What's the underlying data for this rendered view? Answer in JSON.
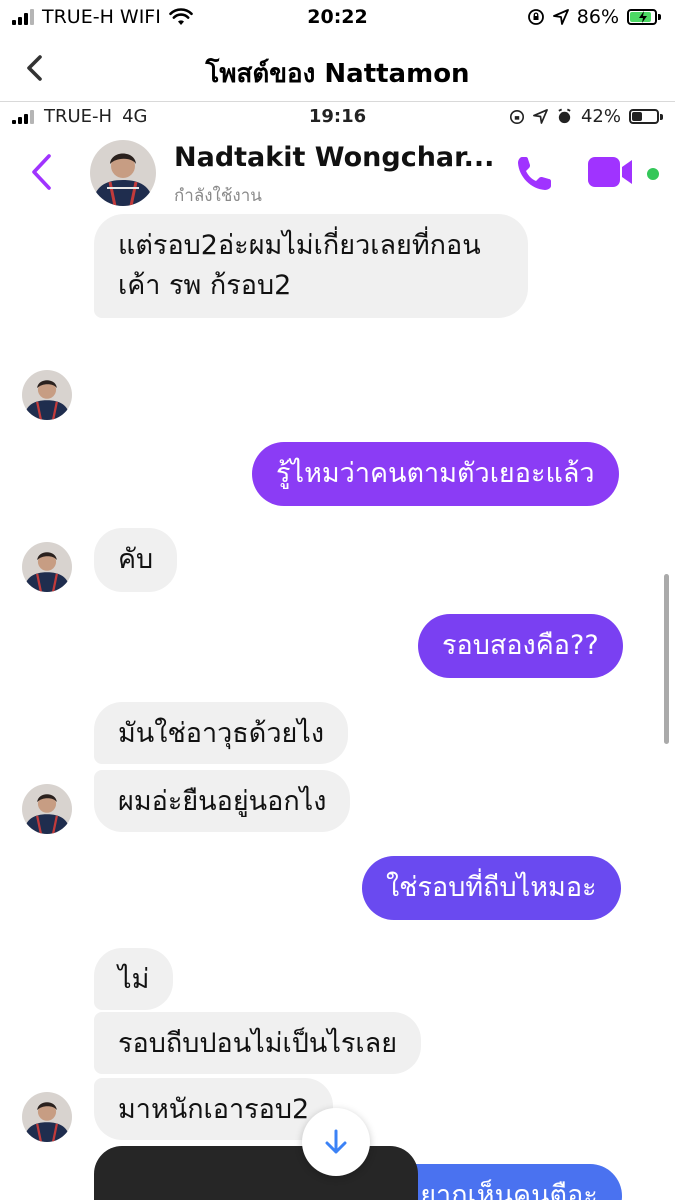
{
  "status_bar": {
    "carrier": "TRUE-H WIFI",
    "time": "20:22",
    "battery_percent": "86%",
    "battery_level": 0.86,
    "icons": [
      "signal-icon",
      "wifi-icon",
      "lock-rotation-icon",
      "location-icon",
      "battery-charging-icon"
    ]
  },
  "nav": {
    "back_icon": "chevron-left-icon",
    "title": "โพสต์ของ Nattamon"
  },
  "inner_status_bar": {
    "carrier": "TRUE-H",
    "network": "4G",
    "time": "19:16",
    "battery_percent": "42%",
    "battery_level": 0.42,
    "icons": [
      "signal-icon",
      "lock-rotation-icon",
      "location-icon",
      "alarm-icon",
      "battery-icon"
    ]
  },
  "chat_header": {
    "contact_name": "Nadtakit Wongchar...",
    "status": "กำลังใช้งาน",
    "accent_color": "#a033ff"
  },
  "messages": [
    {
      "sender": "them",
      "text": "แต่รอบ2อ่ะผมไม่เกี่ยวเลยที่กอน"
    },
    {
      "sender": "them",
      "text": "เค้า รพ ก้รอบ2"
    },
    {
      "sender": "me",
      "text": "รู้ไหมว่าคนตามตัวเยอะแล้ว"
    },
    {
      "sender": "them",
      "text": "คับ"
    },
    {
      "sender": "me",
      "text": "รอบสองคือ??"
    },
    {
      "sender": "them",
      "text": "มันใช่อาวุธด้วยไง"
    },
    {
      "sender": "them",
      "text": "ผมอ่ะยืนอยู่นอกไง"
    },
    {
      "sender": "me",
      "text": "ใช่รอบที่ถีบไหมอะ"
    },
    {
      "sender": "them",
      "text": "ไม่"
    },
    {
      "sender": "them",
      "text": "รอบถีบปอนไม่เป็นไรเลย"
    },
    {
      "sender": "them",
      "text": "มาหนักเอารอบ2"
    },
    {
      "sender": "me",
      "text": "อยากเห็นคนตือะ"
    }
  ],
  "colors": {
    "outgoing_purple": "#8b3cf5",
    "outgoing_violet": "#6a4af0",
    "outgoing_blue": "#4a72f0",
    "incoming_gray": "#f0f0f0"
  }
}
